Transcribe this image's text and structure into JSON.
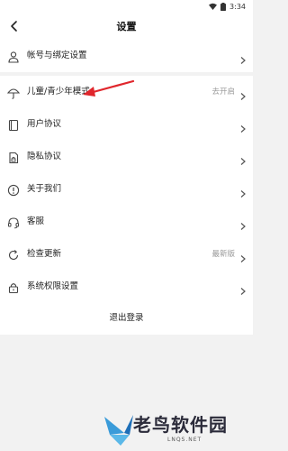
{
  "status_bar": {
    "time": "3:34"
  },
  "header": {
    "title": "设置"
  },
  "groups": [
    {
      "items": [
        {
          "label": "帐号与绑定设置",
          "icon": "person-icon"
        }
      ]
    },
    {
      "items": [
        {
          "label": "儿童/青少年模式",
          "icon": "umbrella-icon",
          "value": "去开启"
        },
        {
          "label": "用户协议",
          "icon": "book-icon"
        },
        {
          "label": "隐私协议",
          "icon": "lock-doc-icon"
        },
        {
          "label": "关于我们",
          "icon": "info-icon"
        },
        {
          "label": "客服",
          "icon": "headset-icon"
        },
        {
          "label": "检查更新",
          "icon": "refresh-icon",
          "value": "最新版"
        },
        {
          "label": "系统权限设置",
          "icon": "lock-icon"
        }
      ]
    }
  ],
  "logout": {
    "label": "退出登录"
  },
  "watermark": {
    "text": "老鸟软件园",
    "sub": "LNQS.NET"
  },
  "colors": {
    "annotation_arrow": "#e0262c",
    "background": "#f2f2f2"
  }
}
